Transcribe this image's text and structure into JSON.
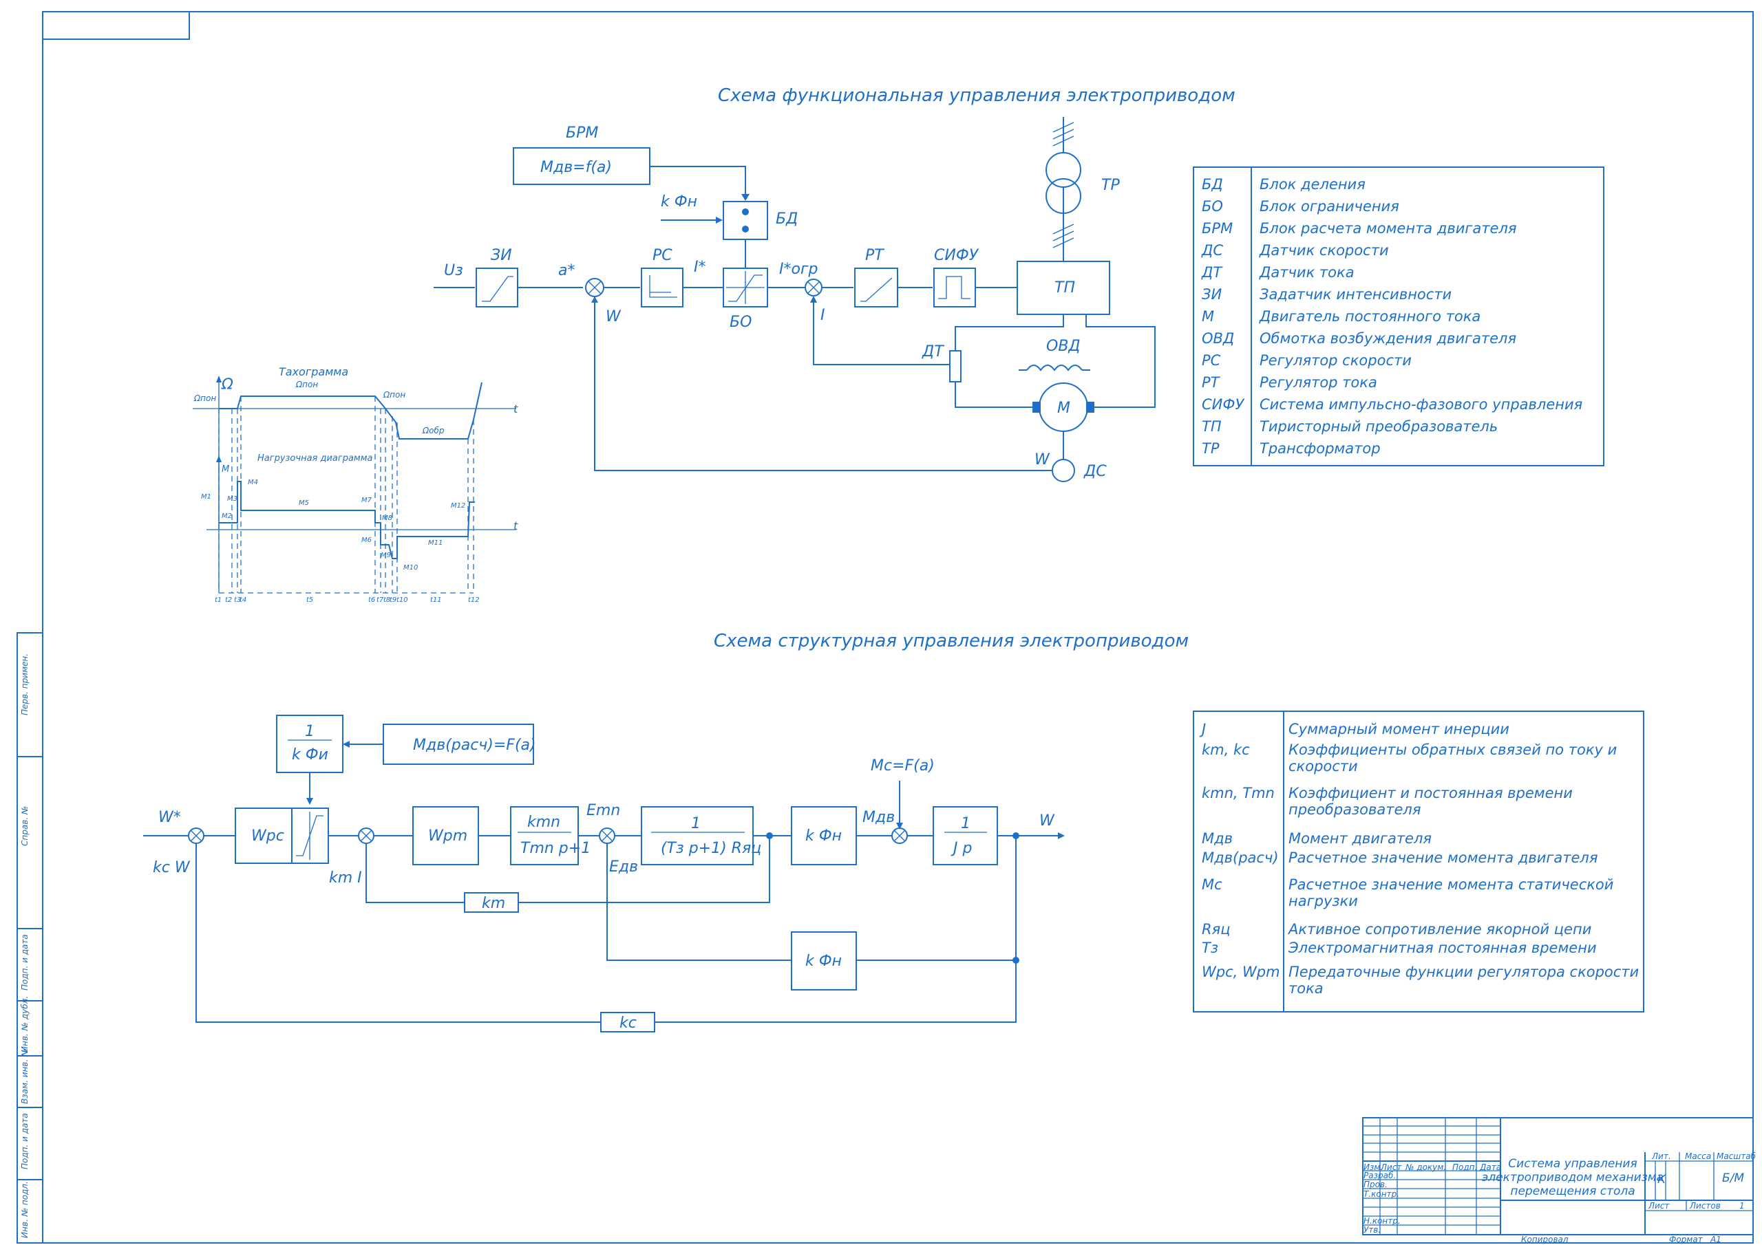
{
  "titles": {
    "functional": "Схема функциональная управления электроприводом",
    "structural": "Схема структурная управления электроприводом"
  },
  "functional": {
    "brm_label": "БРМ",
    "brm_formula": "Мдв=f(a)",
    "kfn_label": "k  Фн",
    "bd_label": "БД",
    "ue_label": "Uз",
    "zi_label": "ЗИ",
    "a_star": "a*",
    "w_label": "W",
    "rs_label": "РС",
    "i_star": "I*",
    "bo_label": "БО",
    "i_ogr": "I*огр",
    "i_label": "I",
    "rt_label": "РТ",
    "sifu_label": "СИФУ",
    "tp_label": "ТП",
    "tr_label": "ТР",
    "dt_label": "ДТ",
    "ovd_label": "ОВД",
    "m_label": "М",
    "ds_label": "ДС",
    "w2_label": "W"
  },
  "tacho": {
    "title": "Тахограмма",
    "omega": "Ω",
    "omega_pon_top": "Ωпон",
    "omega_pon_left": "Ωпон",
    "omega_pon_right": "Ωпон",
    "omega_obr": "Ωобр",
    "t_label": "t",
    "t2_label": "t",
    "m_label": "M",
    "load_title": "Нагрузочная диаграмма",
    "m1": "M1",
    "m2": "M2",
    "m3": "M3",
    "m4": "M4",
    "m5": "M5",
    "m6": "M6",
    "m7": "M7",
    "m8": "M8",
    "m9": "M9",
    "m10": "M10",
    "m11": "M11",
    "m12": "M12",
    "t_ticks": [
      "t1",
      "t2",
      "t3",
      "t4",
      "t5",
      "t6",
      "t7",
      "t8",
      "t9",
      "t10",
      "t11",
      "t12"
    ]
  },
  "legend1": [
    {
      "code": "БД",
      "text": "Блок деления"
    },
    {
      "code": "БО",
      "text": "Блок ограничения"
    },
    {
      "code": "БРМ",
      "text": "Блок расчета момента двигателя"
    },
    {
      "code": "ДС",
      "text": "Датчик скорости"
    },
    {
      "code": "ДТ",
      "text": "Датчик тока"
    },
    {
      "code": "ЗИ",
      "text": "Задатчик интенсивности"
    },
    {
      "code": "М",
      "text": "Двигатель постоянного тока"
    },
    {
      "code": "ОВД",
      "text": "Обмотка возбуждения двигателя"
    },
    {
      "code": "РС",
      "text": "Регулятор скорости"
    },
    {
      "code": "РТ",
      "text": "Регулятор тока"
    },
    {
      "code": "СИФУ",
      "text": "Система импульсно-фазового управления"
    },
    {
      "code": "ТП",
      "text": "Тиристорный преобразователь"
    },
    {
      "code": "ТР",
      "text": "Трансформатор"
    }
  ],
  "structural": {
    "div_num": "1",
    "div_den": "k  Фи",
    "mdv_calc": "Мдв(расч)=F(a)",
    "w_star": "W*",
    "kc_w": "kc W",
    "wpc": "Wpc",
    "km_i": "km I",
    "wpm": "Wpm",
    "ktp_num": "kmn",
    "ktp_den": "Tmn p+1",
    "etn": "Emn",
    "edv": "Eдв",
    "arm_num": "1",
    "arm_den": "(Tз p+1) Rяц",
    "k_fn1": "k  Фн",
    "mdv": "Мдв",
    "mc_eq": "Мс=F(a)",
    "inert_num": "1",
    "inert_den": "J  p",
    "w_out": "W",
    "km": "km",
    "k_fn2": "k  Фн",
    "kc": "kc"
  },
  "legend2": [
    {
      "code": "J",
      "lines": [
        "Суммарный момент инерции"
      ]
    },
    {
      "code": "km, kc",
      "lines": [
        "Коэффициенты обратных связей по току и",
        "скорости"
      ]
    },
    {
      "code": "kmn, Tmn",
      "lines": [
        "Коэффициент и постоянная времени",
        "преобразователя"
      ]
    },
    {
      "code": "Мдв",
      "lines": [
        "Момент двигателя"
      ]
    },
    {
      "code": "Мдв(расч)",
      "lines": [
        "Расчетное значение момента двигателя"
      ]
    },
    {
      "code": "Мс",
      "lines": [
        "Расчетное значение момента статической",
        "нагрузки"
      ]
    },
    {
      "code": "Rяц",
      "lines": [
        "Активное сопротивление якорной цепи"
      ]
    },
    {
      "code": "Тз",
      "lines": [
        "Электромагнитная постоянная времени"
      ]
    },
    {
      "code": "Wpc, Wpm",
      "lines": [
        "Передаточные функции регулятора скорости",
        "тока"
      ]
    }
  ],
  "side_labels": [
    "Перв. примен.",
    "Справ. №",
    "Подп. и дата",
    "Инв. № дубл.",
    "Взам. инв. №",
    "Подп. и дата",
    "Инв. № подл."
  ],
  "stamp": {
    "col_izm": "Изм.",
    "col_list": "Лист",
    "col_doc": "№ докум.",
    "col_podp": "Подп.",
    "col_data": "Дата",
    "row_razrab": "Разраб.",
    "row_prov": "Пров.",
    "row_tkontr": "Т.контр.",
    "row_nkontr": "Н.контр.",
    "row_utv": "Утв.",
    "title_lines": [
      "Система управления",
      "электроприводом механизма",
      "перемещения стола"
    ],
    "lit": "Лит.",
    "massa": "Масса",
    "masshtab": "Масштаб",
    "lit_val": "К",
    "scale_val": "Б/М",
    "list": "Лист",
    "listov": "Листов",
    "listov_val": "1",
    "kopiroval": "Копировал",
    "format": "Формат",
    "format_val": "A1"
  }
}
